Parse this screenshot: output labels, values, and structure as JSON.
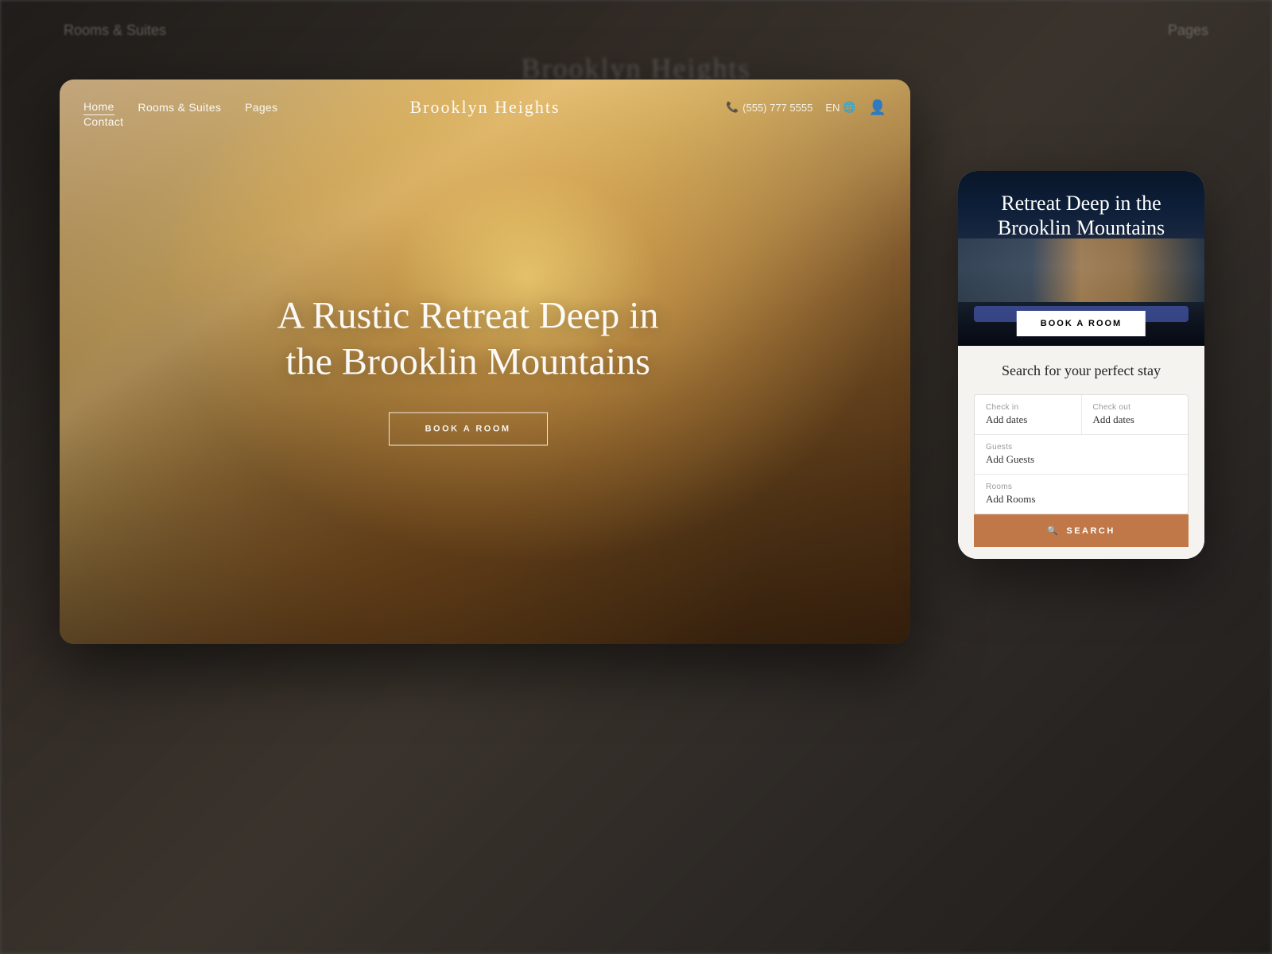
{
  "background": {
    "nav_items": [
      "Rooms & Suites",
      "Pages"
    ]
  },
  "browser": {
    "nav": {
      "items": [
        {
          "label": "Home",
          "active": true
        },
        {
          "label": "Rooms & Suites",
          "active": false
        },
        {
          "label": "Pages",
          "active": false
        }
      ],
      "contact": "Contact",
      "brand": "Brooklyn Heights",
      "phone_icon": "📞",
      "phone": "(555) 777 5555",
      "lang": "EN",
      "globe_icon": "🌐",
      "user_icon": "👤"
    },
    "hero": {
      "title": "A Rustic Retreat Deep in the Brooklin Mountains",
      "book_button": "BOOK A ROOM"
    }
  },
  "mobile_card": {
    "hero_title": "Retreat Deep in the Brooklin Mountains",
    "book_button": "BOOK A ROOM",
    "search_title": "Search for your perfect stay",
    "form": {
      "checkin_label": "Check in",
      "checkin_value": "Add dates",
      "checkout_label": "Check out",
      "checkout_value": "Add dates",
      "guests_label": "Guests",
      "guests_value": "Add Guests",
      "rooms_label": "Rooms",
      "rooms_value": "Add Rooms",
      "search_icon": "🔍",
      "search_button": "SEARCH"
    }
  }
}
